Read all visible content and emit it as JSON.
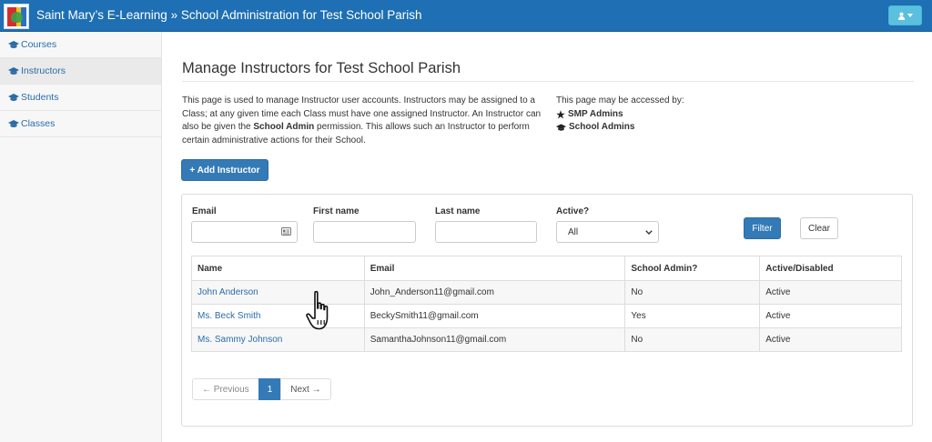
{
  "header": {
    "brand": "Saint Mary’s E-Learning » School Administration for Test School Parish"
  },
  "sidebar": {
    "items": [
      {
        "label": "Courses"
      },
      {
        "label": "Instructors"
      },
      {
        "label": "Students"
      },
      {
        "label": "Classes"
      }
    ]
  },
  "main": {
    "title": "Manage Instructors for Test School Parish",
    "intro": {
      "part1": "This page is used to manage Instructor user accounts. Instructors may be assigned to a Class; at any given time each Class must have one assigned Instructor. An Instructor can also be given the ",
      "bold": "School Admin",
      "part2": " permission. This allows such an Instructor to perform certain administrative actions for their School."
    },
    "access": {
      "heading": "This page may be accessed by:",
      "roles": [
        "SMP Admins",
        "School Admins"
      ]
    },
    "add_button": "+ Add Instructor"
  },
  "filters": {
    "email_label": "Email",
    "email_value": "",
    "first_label": "First name",
    "first_value": "",
    "last_label": "Last name",
    "last_value": "",
    "active_label": "Active?",
    "active_selected": "All",
    "filter_button": "Filter",
    "clear_button": "Clear"
  },
  "table": {
    "headers": [
      "Name",
      "Email",
      "School Admin?",
      "Active/Disabled"
    ],
    "rows": [
      {
        "name": "John Anderson",
        "email": "John_Anderson11@gmail.com",
        "admin": "No",
        "active": "Active"
      },
      {
        "name": "Ms. Beck Smith",
        "email": "BeckySmith11@gmail.com",
        "admin": "Yes",
        "active": "Active"
      },
      {
        "name": "Ms. Sammy Johnson",
        "email": "SamanthaJohnson11@gmail.com",
        "admin": "No",
        "active": "Active"
      }
    ]
  },
  "pagination": {
    "prev": "← Previous",
    "current": "1",
    "next": "Next →"
  },
  "colors": {
    "navbar": "#1e6fb3",
    "primary": "#337ab7",
    "link": "#2a6ca8",
    "user_button": "#5bc0de"
  },
  "icons": {
    "user_menu": "user-icon",
    "nav_items": "graduation-cap-icon",
    "smp_admins": "star-icon",
    "school_admins": "graduation-cap-icon",
    "email_field": "contact-card-icon",
    "cursor": "hand-pointer-icon"
  }
}
